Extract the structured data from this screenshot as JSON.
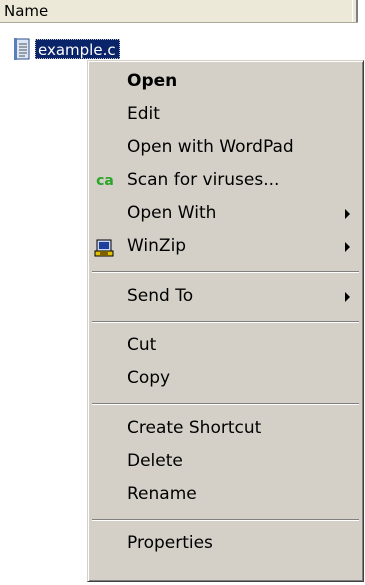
{
  "list": {
    "column_header": "Name",
    "file": {
      "name": "example.c",
      "icon": "text-file-icon"
    }
  },
  "context_menu": {
    "items": [
      {
        "label": "Open",
        "bold": true
      },
      {
        "label": "Edit"
      },
      {
        "label": "Open with WordPad"
      },
      {
        "label": "Scan for viruses...",
        "icon": "ca-antivirus-icon",
        "icon_text": "ca"
      },
      {
        "label": "Open With",
        "submenu": true
      },
      {
        "label": "WinZip",
        "icon": "winzip-icon",
        "submenu": true
      },
      {
        "label": "Send To",
        "submenu": true
      },
      {
        "label": "Cut"
      },
      {
        "label": "Copy"
      },
      {
        "label": "Create Shortcut"
      },
      {
        "label": "Delete"
      },
      {
        "label": "Rename"
      },
      {
        "label": "Properties"
      }
    ]
  },
  "colors": {
    "menu_background": "#d4d0c8",
    "selection": "#0a246a",
    "ca_icon": "#2aa52a"
  }
}
